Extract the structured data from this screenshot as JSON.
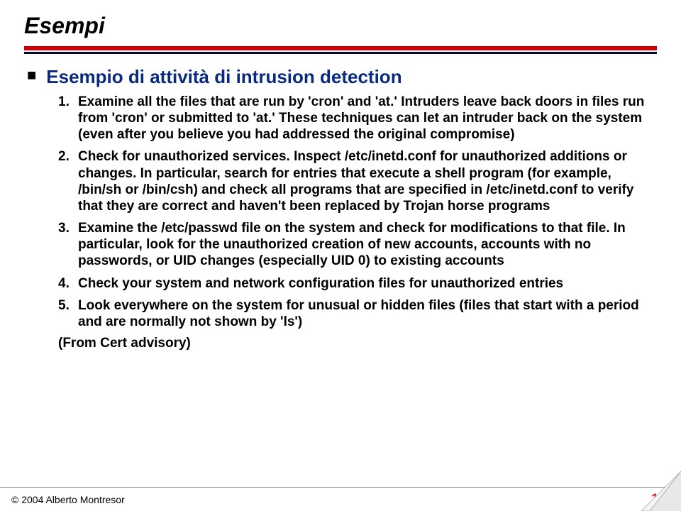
{
  "title": "Esempi",
  "heading": "Esempio di attività di intrusion detection",
  "items": [
    "Examine all the files that are run by 'cron' and 'at.' Intruders leave back doors in files run from 'cron' or submitted to 'at.' These techniques can let an intruder back on the system (even after you believe you had addressed the original compromise)",
    "Check for unauthorized services. Inspect /etc/inetd.conf for unauthorized additions or changes. In particular, search for entries that execute a shell program (for example, /bin/sh or /bin/csh) and check all programs that are specified in /etc/inetd.conf to verify that they are correct and haven't been replaced by Trojan horse programs",
    "Examine the /etc/passwd file on the system and check for modifications to that file. In particular, look for the unauthorized creation of new accounts, accounts with no passwords, or UID changes (especially UID 0) to existing accounts",
    "Check your system and network configuration files for unauthorized entries",
    "Look everywhere on the system for unusual or hidden files (files that start with a period and are normally not shown by 'ls')"
  ],
  "attribution": "(From Cert advisory)",
  "footer": {
    "copyright": "© 2004 Alberto Montresor",
    "page": "11"
  }
}
